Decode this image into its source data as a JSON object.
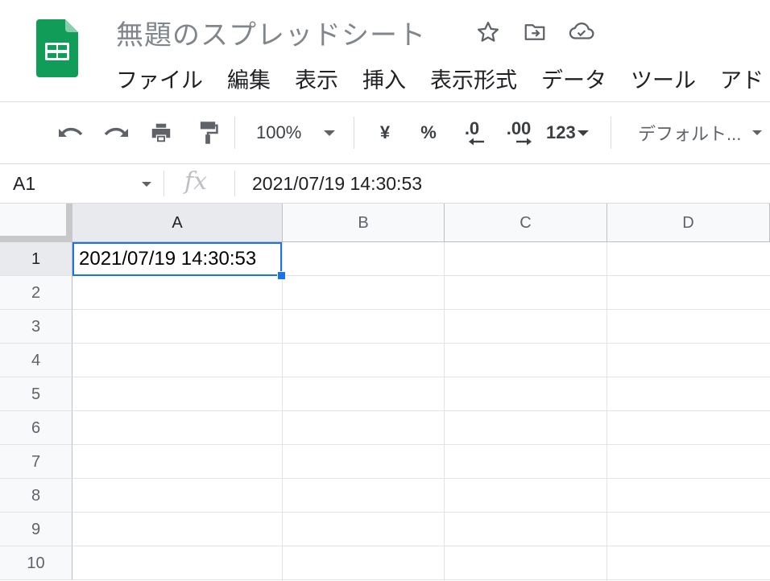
{
  "app": {
    "title": "無題のスプレッドシート",
    "icons": [
      "star-icon",
      "move-to-folder-icon",
      "cloud-saved-icon"
    ],
    "brand_color": "#0F9D58"
  },
  "menu": [
    "ファイル",
    "編集",
    "表示",
    "挿入",
    "表示形式",
    "データ",
    "ツール",
    "アド"
  ],
  "toolbar": {
    "zoom": "100%",
    "currency": "¥",
    "percent": "%",
    "decrease_decimal": ".0",
    "increase_decimal": ".00",
    "number_format": "123",
    "font": "デフォルト...",
    "icons": [
      "undo-icon",
      "redo-icon",
      "print-icon",
      "paint-format-icon"
    ]
  },
  "formula_bar": {
    "name_box": "A1",
    "fx": "fx",
    "value": "2021/07/19 14:30:53"
  },
  "sheet": {
    "columns": [
      "A",
      "B",
      "C",
      "D"
    ],
    "rows": [
      "1",
      "2",
      "3",
      "4",
      "5",
      "6",
      "7",
      "8",
      "9",
      "10"
    ],
    "cells": {
      "A1": "2021/07/19 14:30:53"
    },
    "selected": "A1",
    "selection_color": "#1A73E8"
  }
}
